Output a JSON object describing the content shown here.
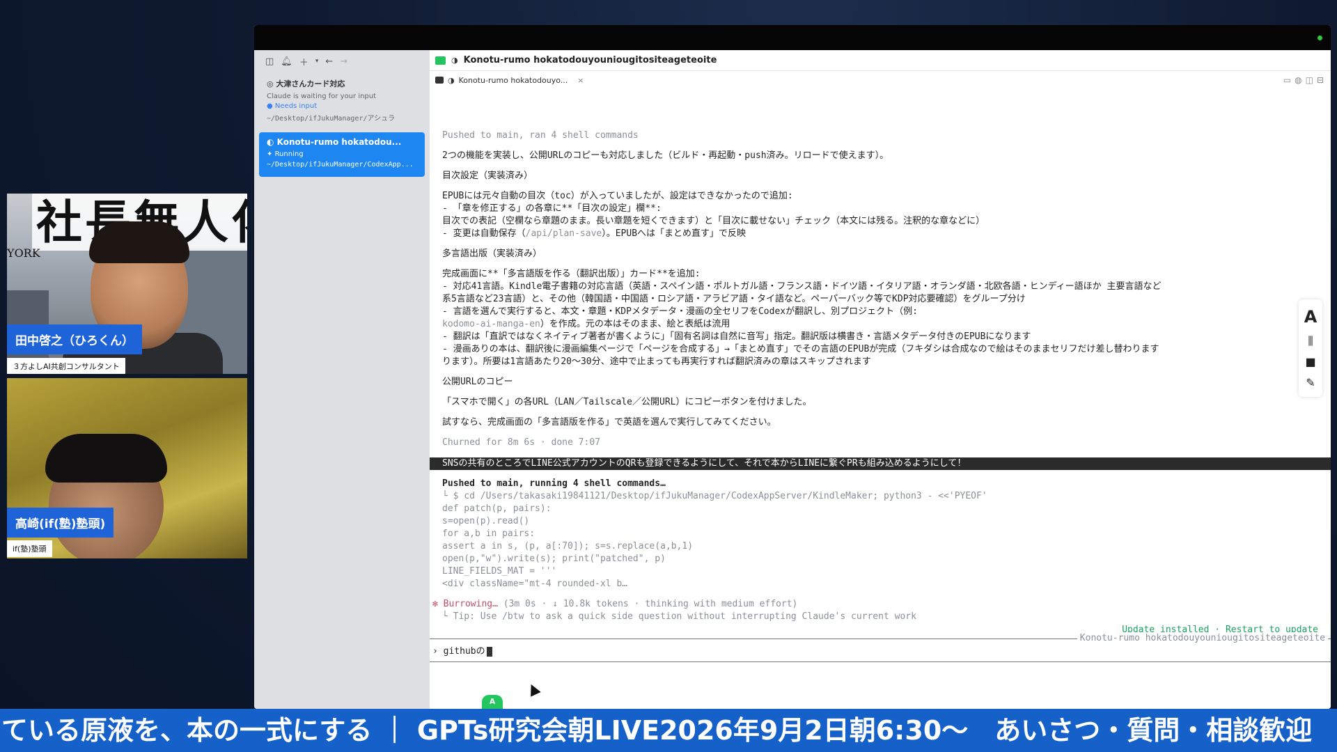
{
  "webcam": {
    "person1": {
      "name": "田中啓之（ひろくん）",
      "subtitle": "３方よしAI共創コンサルタント",
      "banner": "社長無人化",
      "side_text": "YORK"
    },
    "person2": {
      "name": "高崎(if(塾)塾頭)",
      "subtitle": "if(塾)塾頭"
    }
  },
  "sidebar": {
    "session1": {
      "title": "大津さんカード対応",
      "status": "Claude is waiting for your input",
      "badge": "Needs input",
      "path": "~/Desktop/ifJukuManager/アシュラ"
    },
    "session2": {
      "title": "Konotu-rumo hokatodou...",
      "status": "Running",
      "path": "~/Desktop/ifJukuManager/CodexApp..."
    }
  },
  "main": {
    "title": "Konotu-rumo hokatodouyouniougitositeageteoite",
    "tab_label": "Konotu-rumo hokatodouyo...",
    "tab_close": "×"
  },
  "terminal": {
    "l1": "Pushed to main, ran 4 shell commands",
    "l2": "2つの機能を実装し、公開URLのコピーも対応しました（ビルド・再起動・push済み。リロードで使えます）。",
    "l3": "目次設定（実装済み）",
    "l4": "EPUBには元々自動の目次（toc）が入っていましたが、設定はできなかったので追加:",
    "l5": "- 「章を修正する」の各章に**「目次の設定」欄**:",
    "l6": "  目次での表記（空欄なら章題のまま。長い章題を短くできます）と「目次に載せない」チェック（本文には残る。注釈的な章などに）",
    "l7a": "- 変更は自動保存（",
    "l7b": "/api/plan-save",
    "l7c": "）。EPUBへは「まとめ直す」で反映",
    "l8": "多言語出版（実装済み）",
    "l9": "完成画面に**「多言語版を作る（翻訳出版）」カード**を追加:",
    "l10": "- 対応41言語。Kindle電子書籍の対応言語（英語・スペイン語・ポルトガル語・フランス語・ドイツ語・イタリア語・オランダ語・北欧各語・ヒンディー語ほか 主要言語など",
    "l11": "  系5言語など23言語）と、その他（韓国語・中国語・ロシア語・アラビア語・タイ語など。ペーパーバック等でKDP対応要確認）をグループ分け",
    "l12": "- 言語を選んで実行すると、本文・章題・KDPメタデータ・漫画の全セリフをCodexが翻訳し、別プロジェクト（例:",
    "l13a": "  kodomo-ai-manga-en",
    "l13b": "）を作成。元の本はそのまま、絵と表紙は流用",
    "l14": "- 翻訳は「直訳ではなくネイティブ著者が書くように」「固有名詞は自然に音写」指定。翻訳版は横書き・言語メタデータ付きのEPUBになります",
    "l15": "- 漫画ありの本は、翻訳後に漫画編集ページで「ページを合成する」→「まとめ直す」でその言語のEPUBが完成（フキダシは合成なので絵はそのままセリフだけ差し替わります",
    "l16": "  ります）。所要は1言語あたり20〜30分、途中で止まっても再実行すれば翻訳済みの章はスキップされます",
    "l17": "公開URLのコピー",
    "l18": "「スマホで開く」の各URL（LAN／Tailscale／公開URL）にコピーボタンを付けました。",
    "l19": "試すなら、完成画面の「多言語版を作る」で英語を選んで実行してみてください。",
    "l20": "Churned for 8m 6s · done 7:07",
    "user_prompt": "SNSの共有のところでLINE公式アカウントのQRも登録できるようにして、それで本からLINEに繋ぐPRも組み込めるようにして！",
    "l21": "Pushed to main, running 4 shell commands…",
    "l22": "└ $ cd /Users/takasaki19841121/Desktop/ifJukuManager/CodexAppServer/KindleMaker; python3 - <<'PYEOF'",
    "l23": "    def patch(p, pairs):",
    "l24": "    s=open(p).read()",
    "l25": "    for a,b in pairs:",
    "l26": "    assert a in s, (p, a[:70]); s=s.replace(a,b,1)",
    "l27": "    open(p,\"w\").write(s); print(\"patched\", p)",
    "l28": "    LINE_FIELDS_MAT = '''",
    "l29": "    <div className=\"mt-4 rounded-xl b…",
    "l30a": "✻ Burrowing…",
    "l30b": " (3m 0s · ↓ 10.8k tokens · thinking with medium effort)",
    "l31": "└ Tip: Use /btw to ask a quick side question without interrupting Claude's current work",
    "update": "Update installed · Restart to update",
    "session_name": "Konotu-rumo hokatodouyouniougitositeageteoite",
    "input_text": "githubの",
    "input_prompt": "›"
  },
  "ticker": {
    "text": "ている原液を、本の一式にする ｜ GPTs研究会朝LIVE2026年9月2日朝6:30〜　あいさつ・質問・相談歓迎"
  }
}
